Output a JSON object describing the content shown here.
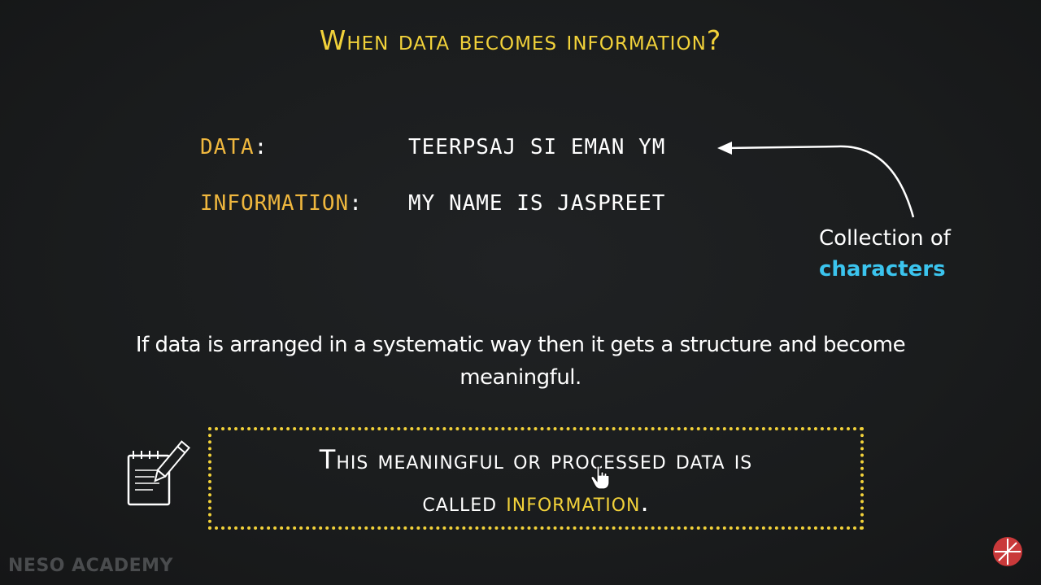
{
  "title": "When data becomes information?",
  "rows": {
    "data_label": "DATA",
    "data_value": "TEERPSAJ SI EMAN YM",
    "info_label": "INFORMATION",
    "info_value": "MY NAME IS JASPREET",
    "colon": ":"
  },
  "annotation": {
    "line1": "Collection of",
    "line2": "characters"
  },
  "statement": "If data is arranged in a systematic way then it gets a structure and become meaningful.",
  "definition": {
    "line1": "This meaningful or processed data is",
    "line2_prefix": "called ",
    "highlight": "information",
    "suffix": "."
  },
  "brand": "NESO ACADEMY",
  "colors": {
    "title": "#f2d23a",
    "label": "#efb73e",
    "accent_blue": "#3bc4ee",
    "logo_red": "#c9393a"
  },
  "icons": [
    "notepad-pencil-icon",
    "hand-cursor-icon",
    "neso-logo-icon"
  ]
}
